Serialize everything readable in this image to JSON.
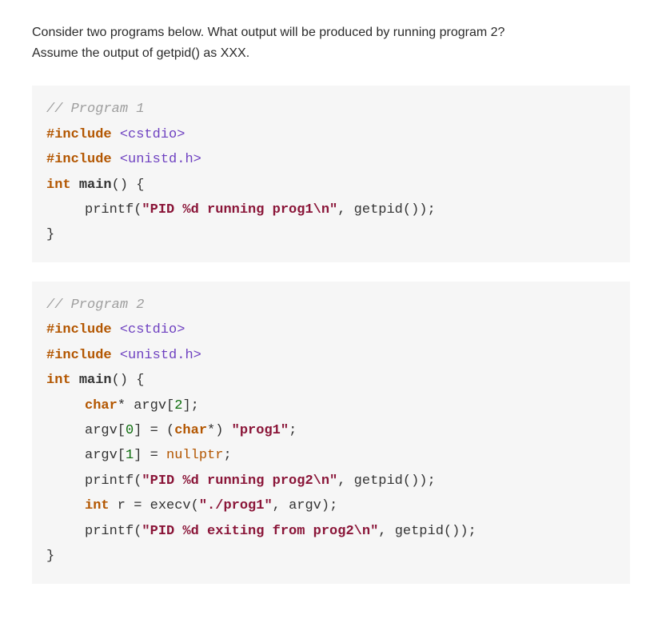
{
  "question": {
    "line1": "Consider two programs below. What output will be produced by running program 2?",
    "line2": "Assume the output of getpid() as XXX."
  },
  "program1": {
    "comment": "// Program 1",
    "inc1_directive": "#include",
    "inc1_header": "<cstdio>",
    "inc2_directive": "#include",
    "inc2_header": "<unistd.h>",
    "sig_int": "int",
    "sig_main": "main",
    "sig_paren": "()",
    "sig_brace_open": " {",
    "printf_name": "printf",
    "printf_open": "(",
    "printf_str": "\"PID %d running prog1\\n\"",
    "printf_comma": ", ",
    "getpid_name": "getpid",
    "getpid_call": "()",
    "printf_close": ");",
    "brace_close": "}"
  },
  "program2": {
    "comment": "// Program 2",
    "inc1_directive": "#include",
    "inc1_header": "<cstdio>",
    "inc2_directive": "#include",
    "inc2_header": "<unistd.h>",
    "sig_int": "int",
    "sig_main": "main",
    "sig_paren": "()",
    "sig_brace_open": " {",
    "decl_char": "char",
    "decl_star": "*",
    "decl_argv": " argv[",
    "decl_argv_size": "2",
    "decl_argv_close": "];",
    "a0_lhs": "argv[",
    "a0_idx": "0",
    "a0_mid": "] = (",
    "a0_cast_char": "char",
    "a0_cast_close": "*) ",
    "a0_str": "\"prog1\"",
    "a0_semi": ";",
    "a1_lhs": "argv[",
    "a1_idx": "1",
    "a1_mid": "] = ",
    "a1_null": "nullptr",
    "a1_semi": ";",
    "p1_name": "printf",
    "p1_open": "(",
    "p1_str": "\"PID %d running prog2\\n\"",
    "p1_comma": ", ",
    "p1_getpid": "getpid",
    "p1_getpid_call": "()",
    "p1_close": ");",
    "r_int": "int",
    "r_name": " r = ",
    "r_execv": "execv",
    "r_open": "(",
    "r_str": "\"./prog1\"",
    "r_comma": ", argv",
    "r_close": ");",
    "p2_name": "printf",
    "p2_open": "(",
    "p2_str": "\"PID %d exiting from prog2\\n\"",
    "p2_comma": ", ",
    "p2_getpid": "getpid",
    "p2_getpid_call": "()",
    "p2_close": ");",
    "brace_close": "}"
  }
}
